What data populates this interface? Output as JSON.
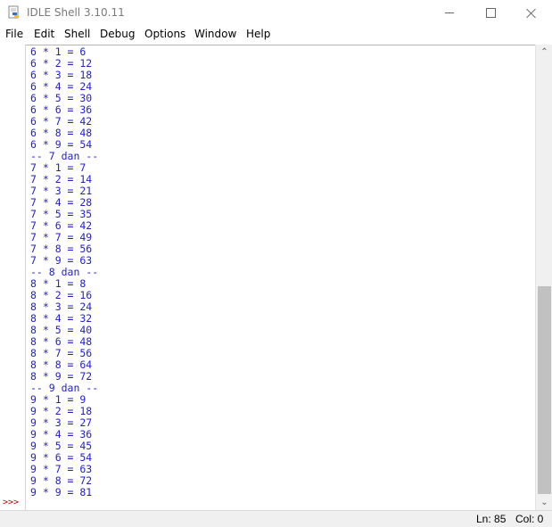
{
  "window": {
    "title": "IDLE Shell 3.10.11",
    "app_icon": "idle-python-icon",
    "controls": [
      "minimize-icon",
      "maximize-icon",
      "close-icon"
    ]
  },
  "menu": [
    "File",
    "Edit",
    "Shell",
    "Debug",
    "Options",
    "Window",
    "Help"
  ],
  "shell": {
    "prompt": ">>>",
    "output_color": "#1f1fd0",
    "prompt_color": "#c00000",
    "lines": [
      "6 * 1 = 6",
      "6 * 2 = 12",
      "6 * 3 = 18",
      "6 * 4 = 24",
      "6 * 5 = 30",
      "6 * 6 = 36",
      "6 * 7 = 42",
      "6 * 8 = 48",
      "6 * 9 = 54",
      "-- 7 dan --",
      "7 * 1 = 7",
      "7 * 2 = 14",
      "7 * 3 = 21",
      "7 * 4 = 28",
      "7 * 5 = 35",
      "7 * 6 = 42",
      "7 * 7 = 49",
      "7 * 8 = 56",
      "7 * 9 = 63",
      "-- 8 dan --",
      "8 * 1 = 8",
      "8 * 2 = 16",
      "8 * 3 = 24",
      "8 * 4 = 32",
      "8 * 5 = 40",
      "8 * 6 = 48",
      "8 * 7 = 56",
      "8 * 8 = 64",
      "8 * 9 = 72",
      "-- 9 dan --",
      "9 * 1 = 9",
      "9 * 2 = 18",
      "9 * 3 = 27",
      "9 * 4 = 36",
      "9 * 5 = 45",
      "9 * 6 = 54",
      "9 * 7 = 63",
      "9 * 8 = 72",
      "9 * 9 = 81"
    ]
  },
  "status": {
    "line": "Ln: 85",
    "col": "Col: 0"
  }
}
